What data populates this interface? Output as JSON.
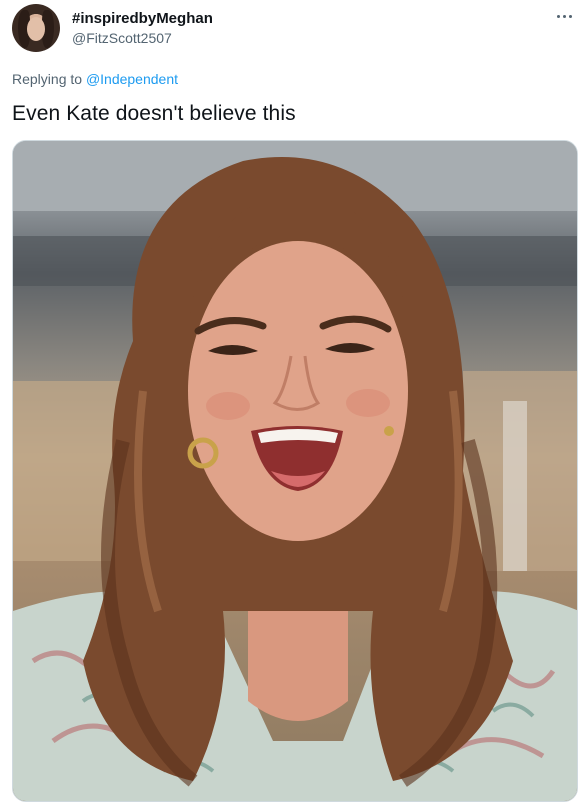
{
  "tweet": {
    "display_name": "#inspiredbyMeghan",
    "handle": "@FitzScott2507",
    "replying_prefix": "Replying to ",
    "replying_to": "@Independent",
    "text": "Even Kate doesn't believe this"
  },
  "icons": {
    "more": "more-horizontal-icon"
  }
}
